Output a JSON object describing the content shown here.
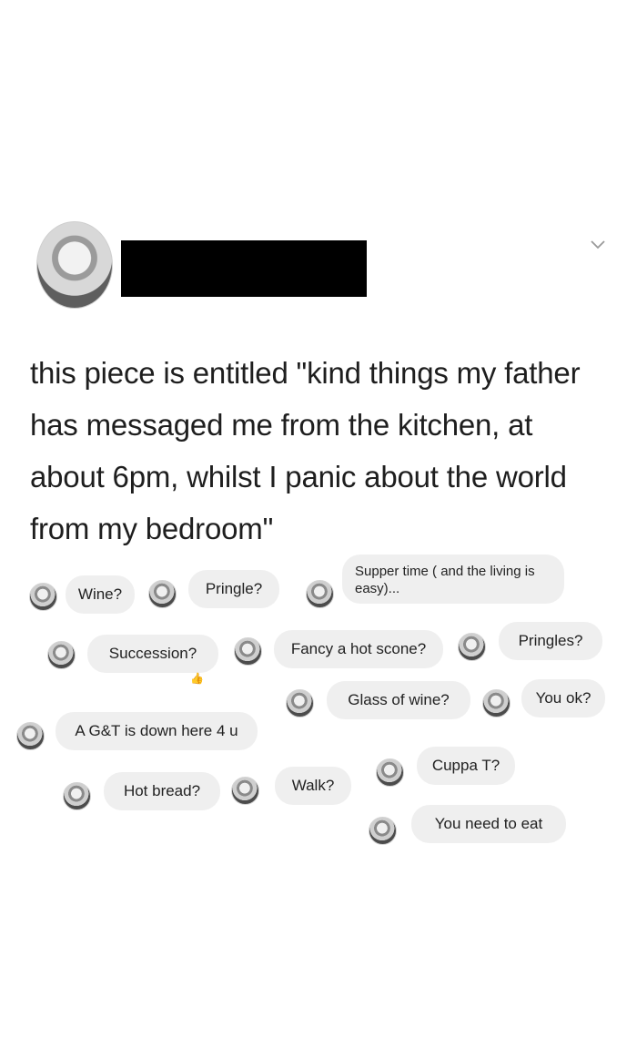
{
  "post": {
    "text": "this piece is entitled \"kind things my father has messaged me from the kitchen, at about 6pm, whilst I panic about the world from my bedroom\"",
    "author_redacted": true
  },
  "icons": {
    "chevron": "chevron-down-icon",
    "reaction": "thumbs-up-icon"
  },
  "messages": [
    "Wine?",
    "Pringle?",
    "Supper time ( and the living is easy)...",
    "Succession?",
    "Fancy a hot scone?",
    "Pringles?",
    "Glass of wine?",
    "You ok?",
    "A G&T is down here 4 u",
    "Cuppa T?",
    "Hot bread?",
    "Walk?",
    "You need to eat"
  ],
  "reaction": "👍",
  "colors": {
    "bubble_bg": "#efefef",
    "text": "#1e1e1e",
    "redaction": "#000000"
  }
}
